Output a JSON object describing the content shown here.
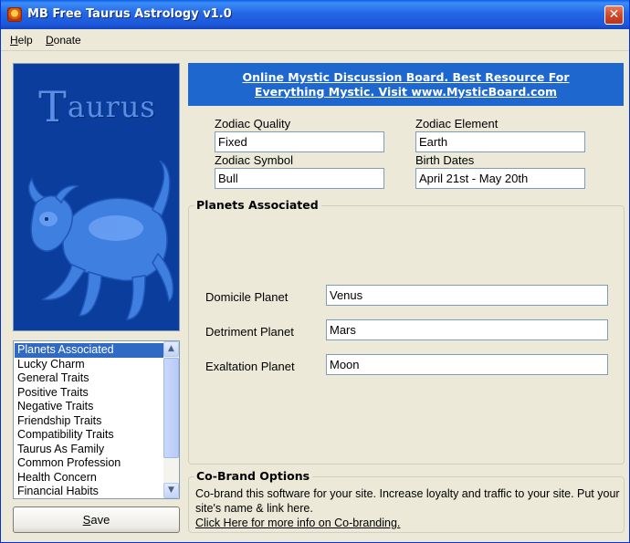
{
  "window": {
    "title": "MB Free Taurus Astrology v1.0",
    "close_glyph": "✕"
  },
  "menu": {
    "help": {
      "mnemonic": "H",
      "rest": "elp"
    },
    "donate": {
      "mnemonic": "D",
      "rest": "onate"
    }
  },
  "banner": {
    "title_initial": "T",
    "title_rest": "aurus"
  },
  "topics": {
    "items": [
      "Planets Associated",
      "Lucky Charm",
      "General Traits",
      "Positive Traits",
      "Negative Traits",
      "Friendship Traits",
      "Compatibility Traits",
      "Taurus As Family",
      "Common Profession",
      "Health Concern",
      "Financial Habits"
    ],
    "selected_index": 0
  },
  "save_button": {
    "mnemonic": "S",
    "rest": "ave"
  },
  "ad_link": {
    "line1": "Online Mystic Discussion Board. Best Resource For",
    "line2": "Everything Mystic. Visit www.MysticBoard.com"
  },
  "info": {
    "zodiac_quality_label": "Zodiac Quality",
    "zodiac_quality_value": "Fixed",
    "zodiac_element_label": "Zodiac Element",
    "zodiac_element_value": "Earth",
    "zodiac_symbol_label": "Zodiac Symbol",
    "zodiac_symbol_value": "Bull",
    "birth_dates_label": "Birth Dates",
    "birth_dates_value": "April 21st - May 20th"
  },
  "planets": {
    "group_title": "Planets Associated",
    "domicile_label": "Domicile Planet",
    "domicile_value": "Venus",
    "detriment_label": "Detriment Planet",
    "detriment_value": "Mars",
    "exaltation_label": "Exaltation Planet",
    "exaltation_value": "Moon"
  },
  "cobrand": {
    "group_title": "Co-Brand Options",
    "text": "Co-brand this software for your site.  Increase loyalty and traffic to your site. Put your site's name &  link here.",
    "link": "Click Here for more info on Co-branding."
  },
  "colors": {
    "titlebar": "#1c57d8",
    "banner": "#0b3d9c",
    "ad_background": "#1d67ce",
    "selection": "#316ac5",
    "window_bg": "#ece9d8"
  }
}
